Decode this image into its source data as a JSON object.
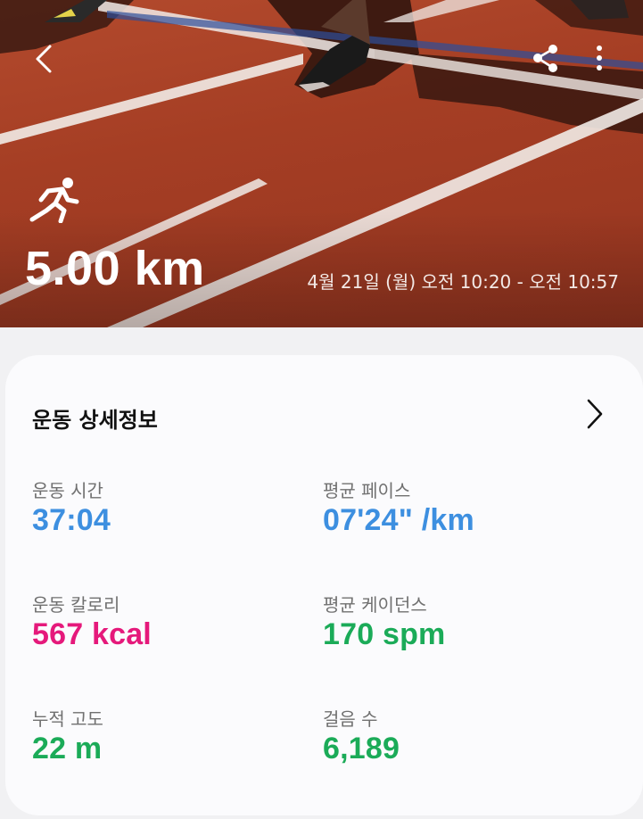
{
  "header": {
    "distance": "5.00 km",
    "datetime": "4월 21일 (월) 오전 10:20 - 오전 10:57"
  },
  "card": {
    "title": "운동 상세정보",
    "stats": [
      {
        "label": "운동 시간",
        "value": "37:04",
        "color": "#3d8fe0"
      },
      {
        "label": "평균 페이스",
        "value": "07'24\" /km",
        "color": "#3d8fe0"
      },
      {
        "label": "운동 칼로리",
        "value": "567 kcal",
        "color": "#e5197b"
      },
      {
        "label": "평균 케이던스",
        "value": "170 spm",
        "color": "#1bab58"
      },
      {
        "label": "누적 고도",
        "value": "22 m",
        "color": "#1bab58"
      },
      {
        "label": "걸음 수",
        "value": "6,189",
        "color": "#1bab58"
      }
    ]
  },
  "icons": {
    "back": "chevron-left-icon",
    "share": "share-icon",
    "more": "more-vertical-icon",
    "activity": "running-icon",
    "detail": "chevron-right-icon"
  }
}
